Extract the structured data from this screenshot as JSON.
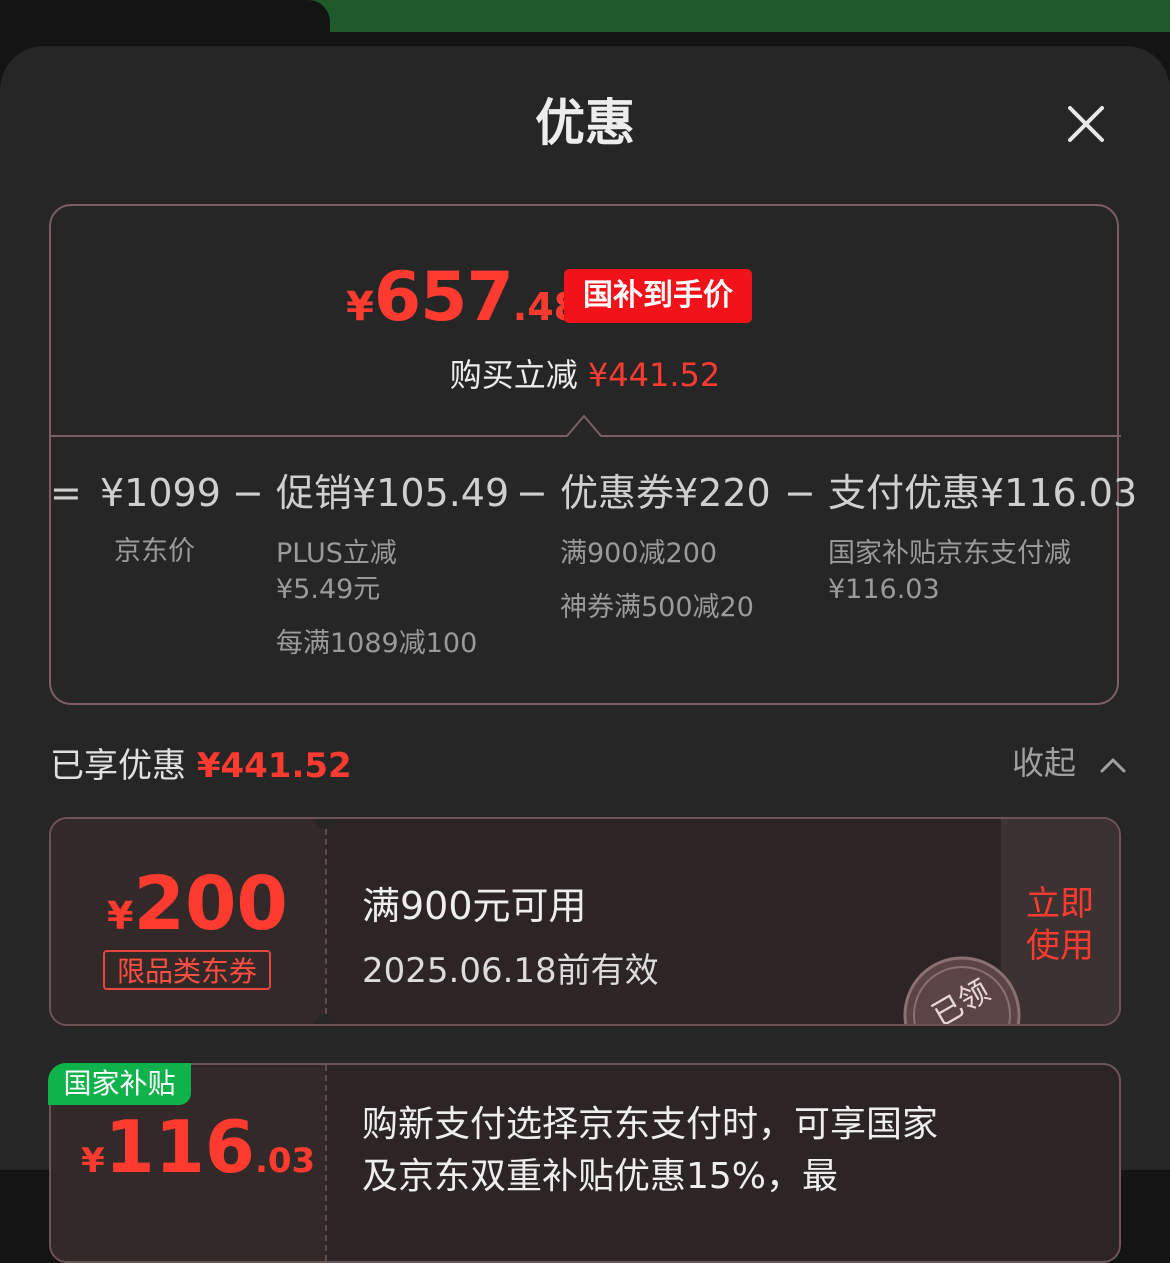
{
  "sheet": {
    "title": "优惠"
  },
  "summary": {
    "final_price_yen": "¥",
    "final_price_int": "657",
    "final_price_dec": ".48",
    "price_badge": "国补到手价",
    "buy_off_label": "购买立减",
    "buy_off_amount": "¥441.52",
    "equals": "=",
    "minus": "−",
    "jd_price": "¥1099",
    "jd_price_label": "京东价",
    "promo": "促销¥105.49",
    "promo_detail_1": "PLUS立减",
    "promo_detail_2": "¥5.49元",
    "promo_detail_3": "每满1089减100",
    "coupon": "优惠券¥220",
    "coupon_detail_1": "满900减200",
    "coupon_detail_2": "神券满500减20",
    "payment": "支付优惠¥116.03",
    "payment_detail_1": "国家补贴京东支付减",
    "payment_detail_2": "¥116.03"
  },
  "enjoyed": {
    "label": "已享优惠",
    "amount": "¥441.52",
    "collapse_label": "收起"
  },
  "coupons": [
    {
      "yen": "¥",
      "amount": "200",
      "tag": "限品类东券",
      "condition": "满900元可用",
      "validity": "2025.06.18前有效",
      "action_line1": "立即",
      "action_line2": "使用",
      "stamp": "已领"
    },
    {
      "badge": "国家补贴",
      "yen": "¥",
      "amount": "116",
      "amount_dec": ".03",
      "desc_line1": "购新支付选择京东支付时，可享国家",
      "desc_line2": "及京东双重补贴优惠15%，最"
    }
  ],
  "colors": {
    "accent_red": "#ff3b30",
    "national_green": "#10b34b",
    "sheet_bg": "#262626"
  },
  "icons": {
    "close": "close-icon",
    "collapse": "chevron-up-icon"
  }
}
